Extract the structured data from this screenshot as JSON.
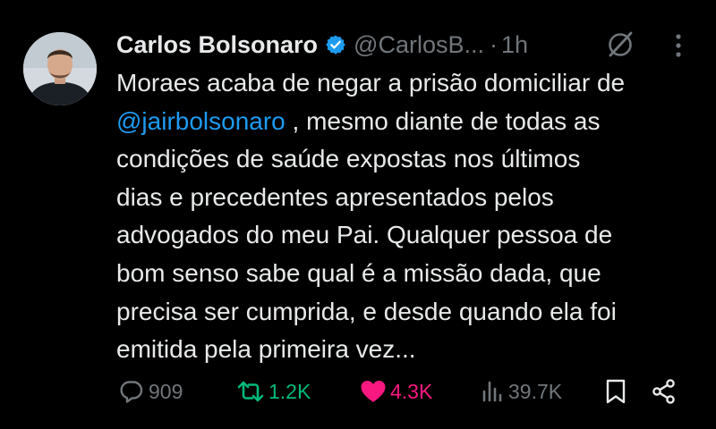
{
  "tweet": {
    "author": {
      "display_name": "Carlos Bolsonaro",
      "handle": "@CarlosB...",
      "verified_icon": "verified-badge-icon"
    },
    "separator": "·",
    "time": "1h",
    "text_lines": [
      {
        "pre": "Moraes acaba de negar a prisão domiciliar de",
        "mention": "",
        "post": ""
      },
      {
        "pre": "",
        "mention": "@jairbolsonaro",
        "post": " , mesmo diante de todas as"
      },
      {
        "pre": "condições de saúde expostas nos últimos",
        "mention": "",
        "post": ""
      },
      {
        "pre": "dias e precedentes apresentados pelos",
        "mention": "",
        "post": ""
      },
      {
        "pre": "advogados do meu Pai. Qualquer pessoa de",
        "mention": "",
        "post": ""
      },
      {
        "pre": "bom senso sabe qual é a missão dada, que",
        "mention": "",
        "post": ""
      },
      {
        "pre": "precisa ser cumprida, e desde quando ela foi",
        "mention": "",
        "post": ""
      },
      {
        "pre": "emitida pela primeira vez...",
        "mention": "",
        "post": ""
      }
    ],
    "actions": {
      "replies": "909",
      "reposts": "1.2K",
      "likes": "4.3K",
      "views": "39.7K"
    },
    "colors": {
      "background": "#000000",
      "text": "#e7e9ea",
      "muted": "#71767b",
      "mention": "#1d9bf0",
      "repost": "#00ba7c",
      "like": "#f91880",
      "verified": "#1d9bf0"
    }
  }
}
